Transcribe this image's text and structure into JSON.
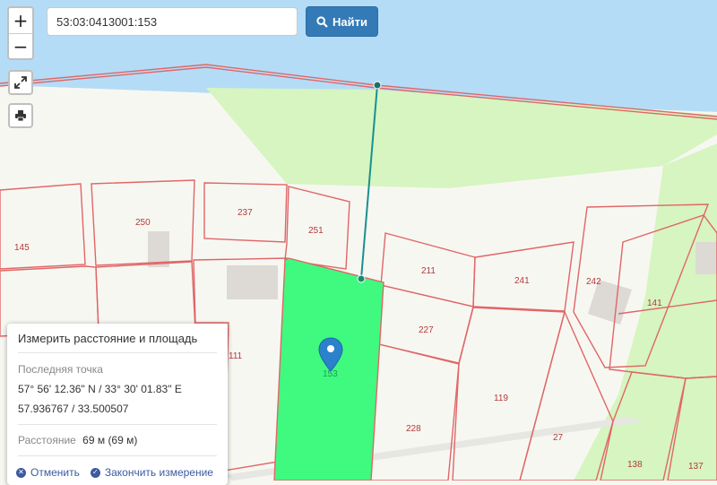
{
  "search": {
    "value": "53:03:0413001:153",
    "button_label": "Найти"
  },
  "zoom": {
    "in_label": "+",
    "out_label": "−"
  },
  "parcels": {
    "p145": "145",
    "p250": "250",
    "p237": "237",
    "p251": "251",
    "p211": "211",
    "p241": "241",
    "p242": "242",
    "p141": "141",
    "p227": "227",
    "p111": "111",
    "p153": "153",
    "p119": "119",
    "p228": "228",
    "p27": "27",
    "p138": "138",
    "p137": "137"
  },
  "measure": {
    "title": "Измерить расстояние и площадь",
    "last_point_label": "Последняя точка",
    "coords_dms": "57° 56' 12.36\" N / 33° 30' 01.83\" E",
    "coords_decimal": "57.936767 / 33.500507",
    "distance_label": "Расстояние",
    "distance_value": "69 м (69 м)",
    "cancel_label": "Отменить",
    "finish_label": "Закончить измерение"
  },
  "icons": {
    "search": "search-icon",
    "fullscreen": "fullscreen-icon",
    "print": "print-icon",
    "marker": "map-marker-icon",
    "cancel": "cancel-icon",
    "finish": "check-icon"
  },
  "colors": {
    "water": "#b5dcf6",
    "grass": "#d6f5c0",
    "parcel_border": "#e06666",
    "selected_parcel": "#3ffa7f",
    "measure_line": "#1a9090",
    "button": "#337ab7",
    "marker": "#2b82cb"
  }
}
